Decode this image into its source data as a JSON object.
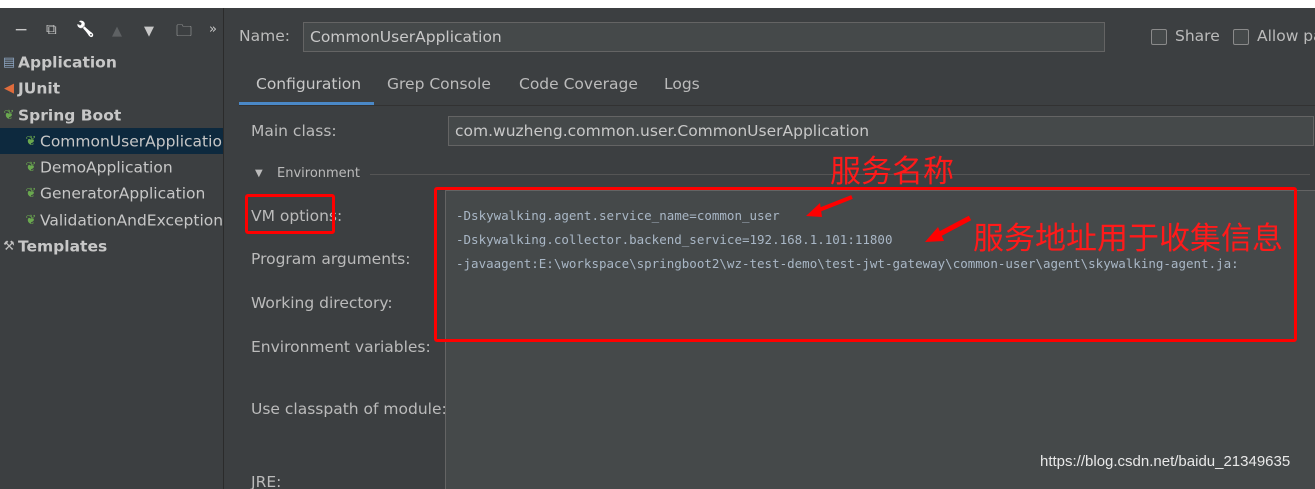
{
  "toolbar": {
    "remove_icon": "−",
    "copy_icon": "⧉",
    "wrench_icon": "🔧",
    "up_icon": "▲",
    "down_icon": "▼",
    "folder_icon": "🗀",
    "more_icon": "»"
  },
  "tree": {
    "items": [
      {
        "label": "Application",
        "icon": "window-icon"
      },
      {
        "label": "JUnit",
        "icon": "junit-icon"
      },
      {
        "label": "Spring Boot",
        "icon": "spring-boot-icon"
      },
      {
        "label": "CommonUserApplication",
        "icon": "spring-app-icon"
      },
      {
        "label": "DemoApplication",
        "icon": "spring-app-error-icon"
      },
      {
        "label": "GeneratorApplication",
        "icon": "spring-app-error-icon"
      },
      {
        "label": "ValidationAndExceptionH",
        "icon": "spring-app-error-icon"
      },
      {
        "label": "Templates",
        "icon": "wrench-icon"
      }
    ]
  },
  "header": {
    "name_label": "Name:",
    "name_value": "CommonUserApplication",
    "share_label": "Share",
    "allow_label": "Allow pa"
  },
  "tabs": [
    "Configuration",
    "Grep Console",
    "Code Coverage",
    "Logs"
  ],
  "form": {
    "main_class_label": "Main class:",
    "main_class_value": "com.wuzheng.common.user.CommonUserApplication",
    "environment_label": "Environment",
    "vm_options_label": "VM options:",
    "vm_options_lines": [
      "-Dskywalking.agent.service_name=common_user",
      "-Dskywalking.collector.backend_service=192.168.1.101:11800",
      "-javaagent:E:\\workspace\\springboot2\\wz-test-demo\\test-jwt-gateway\\common-user\\agent\\skywalking-agent.ja:"
    ],
    "program_args_label": "Program arguments:",
    "working_dir_label": "Working directory:",
    "env_vars_label": "Environment variables:",
    "classpath_label": "Use classpath of module:",
    "jre_label": "JRE:"
  },
  "annotations": {
    "service_name": "服务名称",
    "service_address": "服务地址用于收集信息",
    "color": "#ff0000"
  },
  "watermark": "https://blog.csdn.net/baidu_21349635",
  "colors": {
    "background": "#3c3f41",
    "selection": "#0d293e",
    "accent": "#4a88c7",
    "field": "#45494a"
  }
}
